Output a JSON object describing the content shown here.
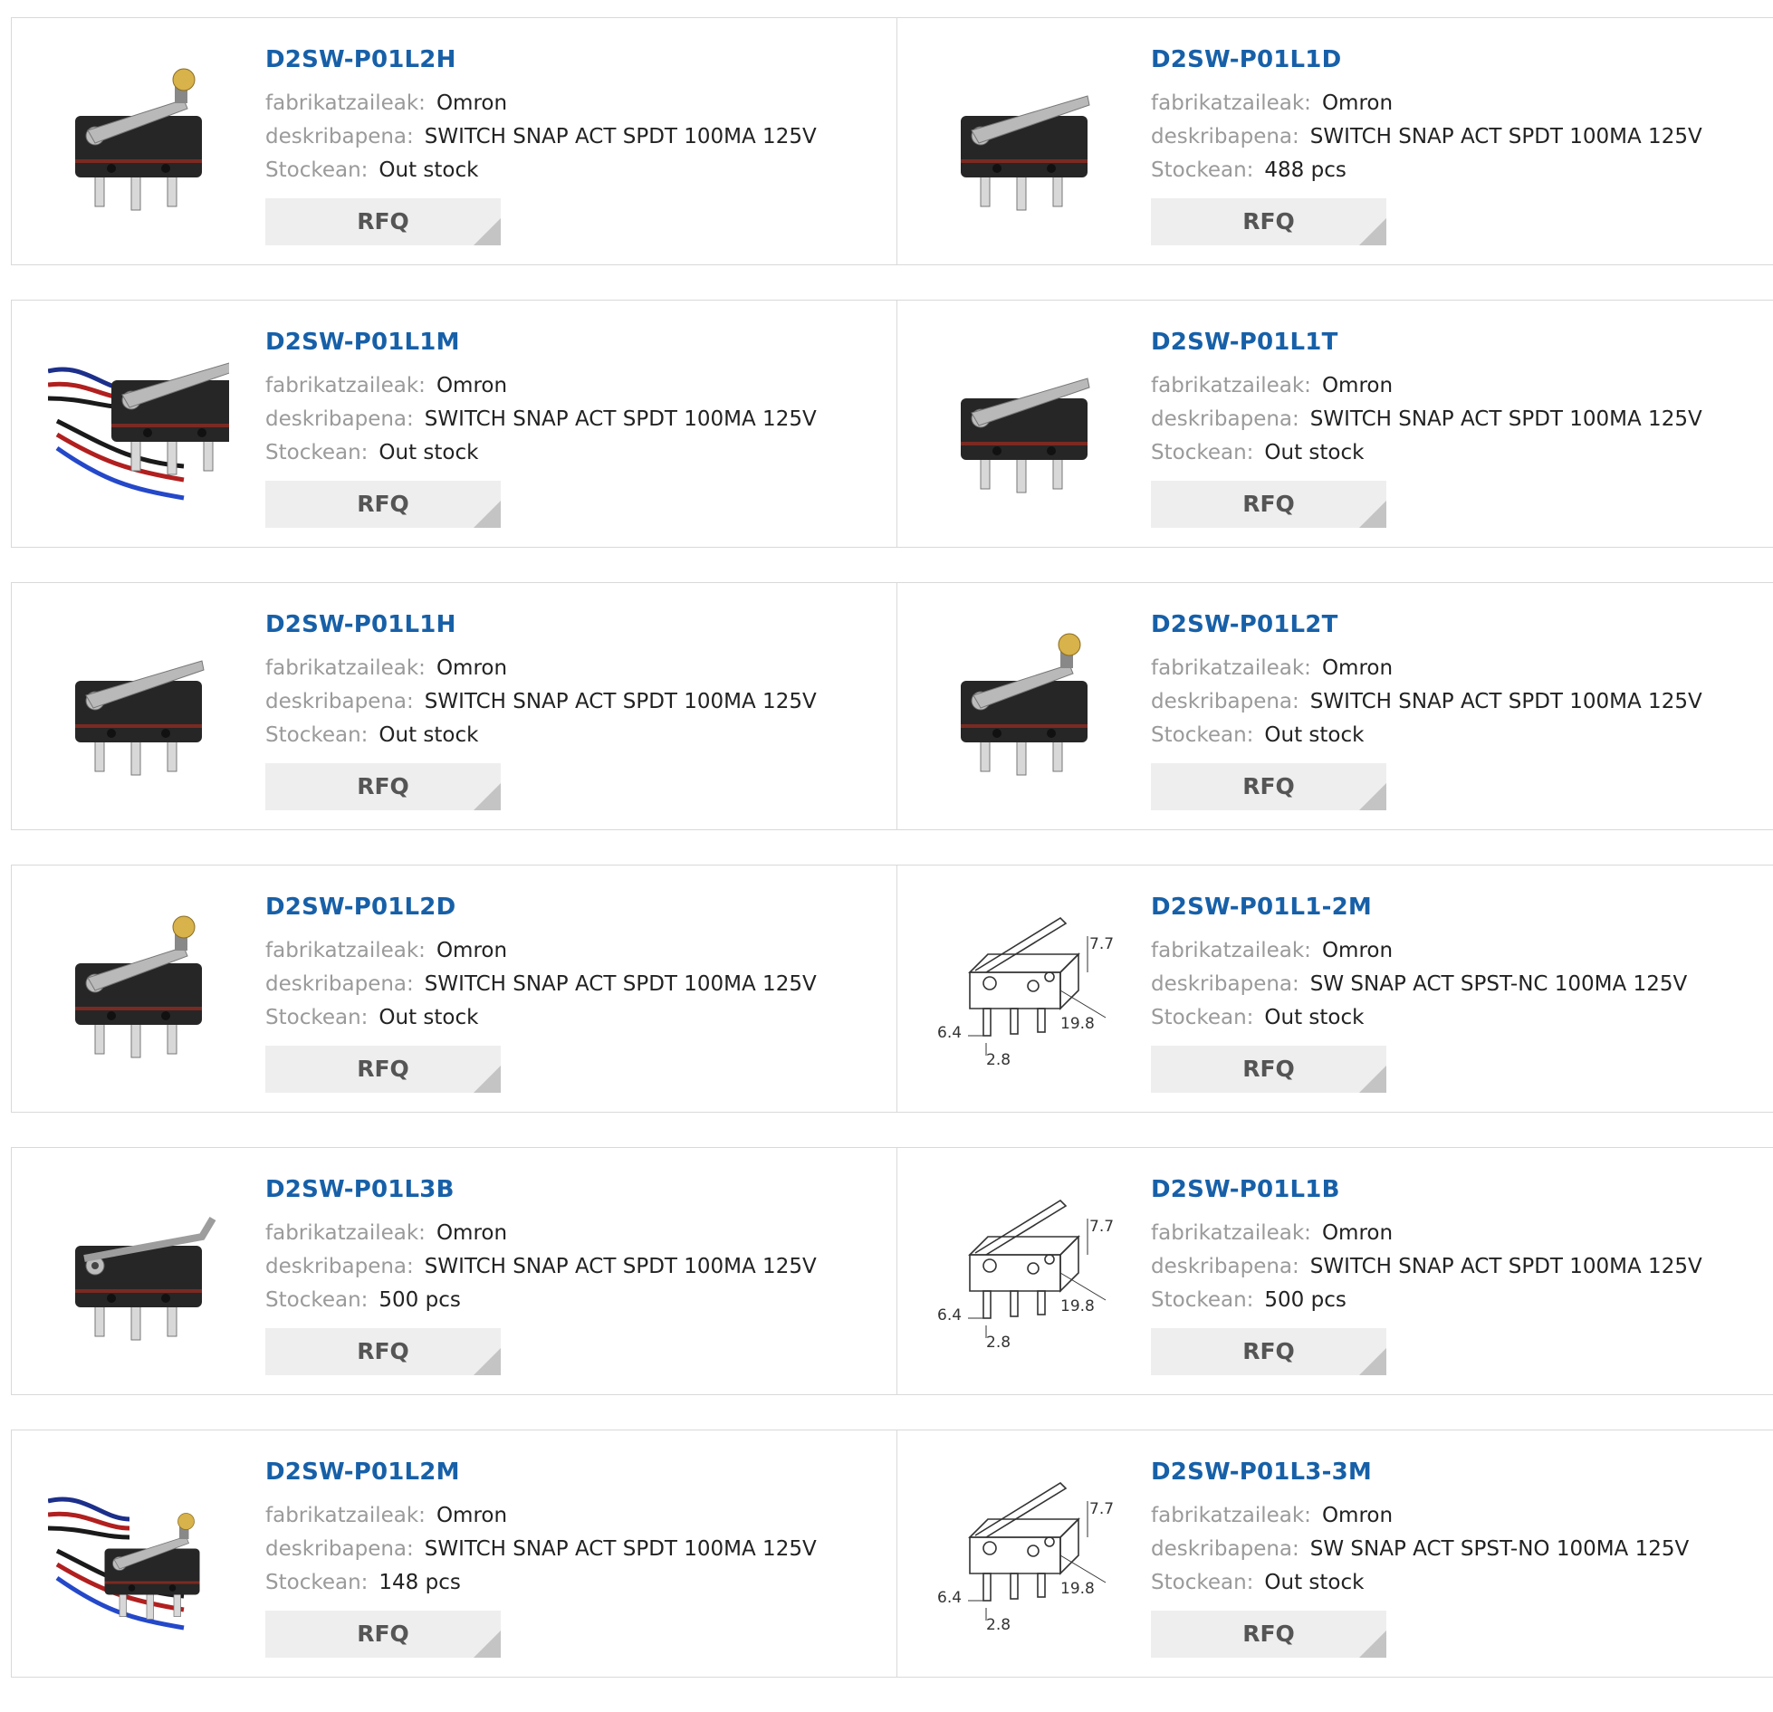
{
  "labels": {
    "manufacturer": "fabrikatzaileak:",
    "description": "deskribapena:",
    "stock": "Stockean:",
    "rfq": "RFQ"
  },
  "products": [
    {
      "part": "D2SW-P01L2H",
      "manufacturer": "Omron",
      "description": "SWITCH SNAP ACT SPDT 100MA 125V",
      "stock": "Out stock",
      "image": "roller-lever-switch"
    },
    {
      "part": "D2SW-P01L1D",
      "manufacturer": "Omron",
      "description": "SWITCH SNAP ACT SPDT 100MA 125V",
      "stock": "488 pcs",
      "image": "hinge-lever-switch"
    },
    {
      "part": "D2SW-P01L1M",
      "manufacturer": "Omron",
      "description": "SWITCH SNAP ACT SPDT 100MA 125V",
      "stock": "Out stock",
      "image": "wired-lever-switch"
    },
    {
      "part": "D2SW-P01L1T",
      "manufacturer": "Omron",
      "description": "SWITCH SNAP ACT SPDT 100MA 125V",
      "stock": "Out stock",
      "image": "hinge-lever-switch"
    },
    {
      "part": "D2SW-P01L1H",
      "manufacturer": "Omron",
      "description": "SWITCH SNAP ACT SPDT 100MA 125V",
      "stock": "Out stock",
      "image": "hinge-lever-switch"
    },
    {
      "part": "D2SW-P01L2T",
      "manufacturer": "Omron",
      "description": "SWITCH SNAP ACT SPDT 100MA 125V",
      "stock": "Out stock",
      "image": "roller-lever-switch"
    },
    {
      "part": "D2SW-P01L2D",
      "manufacturer": "Omron",
      "description": "SWITCH SNAP ACT SPDT 100MA 125V",
      "stock": "Out stock",
      "image": "roller-lever-switch"
    },
    {
      "part": "D2SW-P01L1-2M",
      "manufacturer": "Omron",
      "description": "SW SNAP ACT SPST-NC 100MA 125V",
      "stock": "Out stock",
      "image": "dimension-drawing",
      "dims": [
        "7.7",
        "19.8",
        "6.4",
        "2.8"
      ]
    },
    {
      "part": "D2SW-P01L3B",
      "manufacturer": "Omron",
      "description": "SWITCH SNAP ACT SPDT 100MA 125V",
      "stock": "500 pcs",
      "image": "simulated-roller-switch"
    },
    {
      "part": "D2SW-P01L1B",
      "manufacturer": "Omron",
      "description": "SWITCH SNAP ACT SPDT 100MA 125V",
      "stock": "500 pcs",
      "image": "dimension-drawing",
      "dims": [
        "7.7",
        "19.8",
        "6.4",
        "2.8"
      ]
    },
    {
      "part": "D2SW-P01L2M",
      "manufacturer": "Omron",
      "description": "SWITCH SNAP ACT SPDT 100MA 125V",
      "stock": "148 pcs",
      "image": "wired-roller-switch"
    },
    {
      "part": "D2SW-P01L3-3M",
      "manufacturer": "Omron",
      "description": "SW SNAP ACT SPST-NO 100MA 125V",
      "stock": "Out stock",
      "image": "dimension-drawing",
      "dims": [
        "7.7",
        "19.8",
        "6.4",
        "2.8"
      ]
    }
  ]
}
